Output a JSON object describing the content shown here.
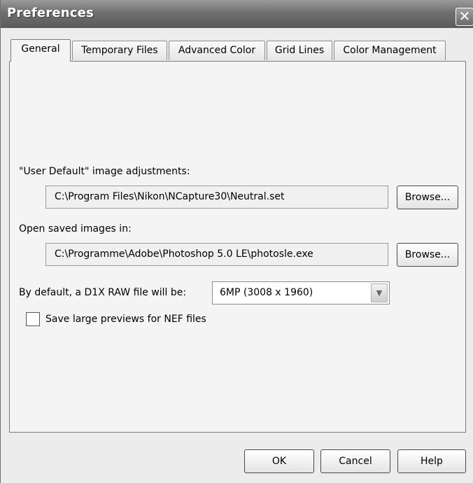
{
  "window": {
    "title": "Preferences",
    "close_glyph": "✕"
  },
  "tabs": [
    {
      "label": "General",
      "active": true
    },
    {
      "label": "Temporary Files",
      "active": false
    },
    {
      "label": "Advanced Color",
      "active": false
    },
    {
      "label": "Grid Lines",
      "active": false
    },
    {
      "label": "Color Management",
      "active": false
    }
  ],
  "general": {
    "user_default_label": "\"User Default\" image adjustments:",
    "user_default_path": "C:\\Program Files\\Nikon\\NCapture30\\Neutral.set",
    "browse_label_1": "Browse...",
    "open_saved_label": "Open saved images in:",
    "open_saved_path": "C:\\Programme\\Adobe\\Photoshop 5.0 LE\\photosle.exe",
    "browse_label_2": "Browse...",
    "raw_default_label": "By default, a D1X RAW file will be:",
    "raw_default_value": "6MP (3008 x 1960)",
    "large_previews_label": "Save large previews for NEF files",
    "large_previews_checked": false
  },
  "footer": {
    "ok_label": "OK",
    "cancel_label": "Cancel",
    "help_label": "Help"
  },
  "icons": {
    "dropdown": "chevron-down-icon",
    "close": "close-icon"
  }
}
